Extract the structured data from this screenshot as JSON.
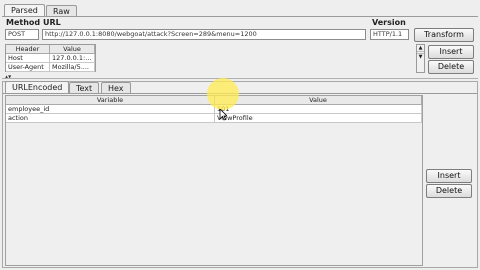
{
  "tabs": {
    "parsed": "Parsed",
    "raw": "Raw"
  },
  "request": {
    "method_label": "Method",
    "url_label": "URL",
    "version_label": "Version",
    "method": "POST",
    "url": "http://127.0.0.1:8080/webgoat/attack?Screen=289&menu=1200",
    "version": "HTTP/1.1",
    "transform_label": "Transform"
  },
  "headers": {
    "col_header": "Header",
    "col_value": "Value",
    "rows": [
      {
        "header": "Host",
        "value": "127.0.0.1:..."
      },
      {
        "header": "User-Agent",
        "value": "Mozilla/5...."
      }
    ],
    "insert_label": "Insert",
    "delete_label": "Delete"
  },
  "content_tabs": {
    "urlencoded": "URLEncoded",
    "text": "Text",
    "hex": "Hex"
  },
  "params": {
    "col_variable": "Variable",
    "col_value": "Value",
    "rows": [
      {
        "variable": "employee_id",
        "value": "101"
      },
      {
        "variable": "action",
        "value": "ViewProfile"
      }
    ],
    "insert_label": "Insert",
    "delete_label": "Delete"
  }
}
